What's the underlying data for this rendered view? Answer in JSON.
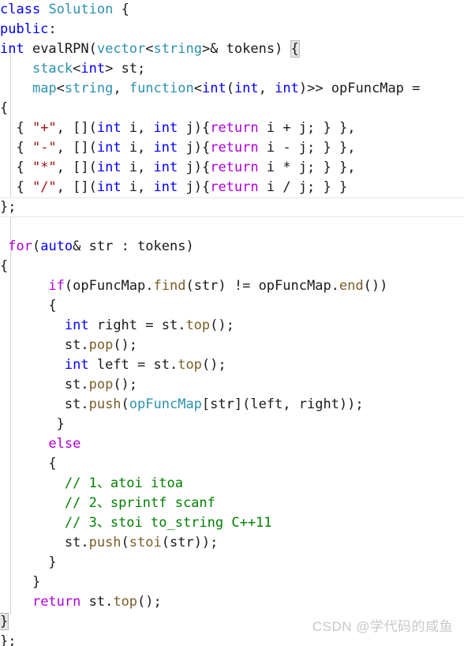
{
  "editor": {
    "language": "cpp",
    "theme": "light",
    "colors": {
      "background": "#ffffff",
      "foreground": "#1a1a1a",
      "keyword": "#0000ff",
      "control_keyword": "#af00db",
      "type": "#2b91af",
      "function": "#795e26",
      "string": "#a31515",
      "comment": "#008000",
      "indent_guide": "#d3d3d3",
      "bracket_match": "#e6e6e6",
      "watermark": "#c8c8c8"
    }
  },
  "code_lines": [
    {
      "id": "line-1",
      "tokens": [
        {
          "t": "class",
          "c": "kw"
        },
        {
          "t": " ",
          "c": "pln"
        },
        {
          "t": "Solution",
          "c": "typ"
        },
        {
          "t": " ",
          "c": "pln"
        },
        {
          "t": "{",
          "c": "brk"
        }
      ]
    },
    {
      "id": "line-2",
      "tokens": [
        {
          "t": "public",
          "c": "kw"
        },
        {
          "t": ":",
          "c": "pln"
        }
      ]
    },
    {
      "id": "line-3",
      "tokens": [
        {
          "t": "int",
          "c": "kw"
        },
        {
          "t": " evalRPN(",
          "c": "pln"
        },
        {
          "t": "vector",
          "c": "typ"
        },
        {
          "t": "<",
          "c": "pln"
        },
        {
          "t": "string",
          "c": "typ"
        },
        {
          "t": ">& tokens) ",
          "c": "pln"
        },
        {
          "t": "{",
          "c": "brk bmatch"
        }
      ]
    },
    {
      "id": "line-4",
      "tokens": [
        {
          "t": "    ",
          "c": "pln"
        },
        {
          "t": "stack",
          "c": "typ"
        },
        {
          "t": "<",
          "c": "pln"
        },
        {
          "t": "int",
          "c": "kw"
        },
        {
          "t": "> st;",
          "c": "pln"
        }
      ]
    },
    {
      "id": "line-5",
      "tokens": [
        {
          "t": "    ",
          "c": "pln"
        },
        {
          "t": "map",
          "c": "typ"
        },
        {
          "t": "<",
          "c": "pln"
        },
        {
          "t": "string",
          "c": "typ"
        },
        {
          "t": ", ",
          "c": "pln"
        },
        {
          "t": "function",
          "c": "typ"
        },
        {
          "t": "<",
          "c": "pln"
        },
        {
          "t": "int",
          "c": "kw"
        },
        {
          "t": "(",
          "c": "pln"
        },
        {
          "t": "int",
          "c": "kw"
        },
        {
          "t": ", ",
          "c": "pln"
        },
        {
          "t": "int",
          "c": "kw"
        },
        {
          "t": ")>> opFuncMap =",
          "c": "pln"
        }
      ]
    },
    {
      "id": "line-6",
      "tokens": [
        {
          "t": "{",
          "c": "brk"
        }
      ]
    },
    {
      "id": "line-7",
      "tokens": [
        {
          "t": "  { ",
          "c": "pln"
        },
        {
          "t": "\"+\"",
          "c": "str"
        },
        {
          "t": ", [](",
          "c": "pln"
        },
        {
          "t": "int",
          "c": "kw"
        },
        {
          "t": " i, ",
          "c": "pln"
        },
        {
          "t": "int",
          "c": "kw"
        },
        {
          "t": " j){",
          "c": "pln"
        },
        {
          "t": "return",
          "c": "ctl"
        },
        {
          "t": " i + j; } },",
          "c": "pln"
        }
      ]
    },
    {
      "id": "line-8",
      "tokens": [
        {
          "t": "  { ",
          "c": "pln"
        },
        {
          "t": "\"-\"",
          "c": "str"
        },
        {
          "t": ", [](",
          "c": "pln"
        },
        {
          "t": "int",
          "c": "kw"
        },
        {
          "t": " i, ",
          "c": "pln"
        },
        {
          "t": "int",
          "c": "kw"
        },
        {
          "t": " j){",
          "c": "pln"
        },
        {
          "t": "return",
          "c": "ctl"
        },
        {
          "t": " i - j; } },",
          "c": "pln"
        }
      ]
    },
    {
      "id": "line-9",
      "tokens": [
        {
          "t": "  { ",
          "c": "pln"
        },
        {
          "t": "\"*\"",
          "c": "str"
        },
        {
          "t": ", [](",
          "c": "pln"
        },
        {
          "t": "int",
          "c": "kw"
        },
        {
          "t": " i, ",
          "c": "pln"
        },
        {
          "t": "int",
          "c": "kw"
        },
        {
          "t": " j){",
          "c": "pln"
        },
        {
          "t": "return",
          "c": "ctl"
        },
        {
          "t": " i * j; } },",
          "c": "pln"
        }
      ]
    },
    {
      "id": "line-10",
      "tokens": [
        {
          "t": "  { ",
          "c": "pln"
        },
        {
          "t": "\"/\"",
          "c": "str"
        },
        {
          "t": ", [](",
          "c": "pln"
        },
        {
          "t": "int",
          "c": "kw"
        },
        {
          "t": " i, ",
          "c": "pln"
        },
        {
          "t": "int",
          "c": "kw"
        },
        {
          "t": " j){",
          "c": "pln"
        },
        {
          "t": "return",
          "c": "ctl"
        },
        {
          "t": " i / j; } }",
          "c": "pln"
        }
      ]
    },
    {
      "id": "line-11",
      "current": true,
      "tokens": [
        {
          "t": "};",
          "c": "pln"
        }
      ]
    },
    {
      "id": "line-12",
      "tokens": []
    },
    {
      "id": "line-13",
      "tokens": [
        {
          "t": " ",
          "c": "pln"
        },
        {
          "t": "for",
          "c": "ctl"
        },
        {
          "t": "(",
          "c": "pln"
        },
        {
          "t": "auto",
          "c": "kw"
        },
        {
          "t": "& str : tokens)",
          "c": "pln"
        }
      ]
    },
    {
      "id": "line-14",
      "tokens": [
        {
          "t": "{",
          "c": "brk"
        }
      ]
    },
    {
      "id": "line-15",
      "tokens": [
        {
          "t": "      ",
          "c": "pln"
        },
        {
          "t": "if",
          "c": "ctl"
        },
        {
          "t": "(opFuncMap.",
          "c": "pln"
        },
        {
          "t": "find",
          "c": "fn"
        },
        {
          "t": "(str) != opFuncMap.",
          "c": "pln"
        },
        {
          "t": "end",
          "c": "fn"
        },
        {
          "t": "())",
          "c": "pln"
        }
      ]
    },
    {
      "id": "line-16",
      "tokens": [
        {
          "t": "      {",
          "c": "pln"
        }
      ]
    },
    {
      "id": "line-17",
      "tokens": [
        {
          "t": "        ",
          "c": "pln"
        },
        {
          "t": "int",
          "c": "kw"
        },
        {
          "t": " right = st.",
          "c": "pln"
        },
        {
          "t": "top",
          "c": "fn"
        },
        {
          "t": "();",
          "c": "pln"
        }
      ]
    },
    {
      "id": "line-18",
      "tokens": [
        {
          "t": "        st.",
          "c": "pln"
        },
        {
          "t": "pop",
          "c": "fn"
        },
        {
          "t": "();",
          "c": "pln"
        }
      ]
    },
    {
      "id": "line-19",
      "tokens": [
        {
          "t": "        ",
          "c": "pln"
        },
        {
          "t": "int",
          "c": "kw"
        },
        {
          "t": " left = st.",
          "c": "pln"
        },
        {
          "t": "top",
          "c": "fn"
        },
        {
          "t": "();",
          "c": "pln"
        }
      ]
    },
    {
      "id": "line-20",
      "tokens": [
        {
          "t": "        st.",
          "c": "pln"
        },
        {
          "t": "pop",
          "c": "fn"
        },
        {
          "t": "();",
          "c": "pln"
        }
      ]
    },
    {
      "id": "line-21",
      "tokens": [
        {
          "t": "        st.",
          "c": "pln"
        },
        {
          "t": "push",
          "c": "fn"
        },
        {
          "t": "(",
          "c": "pln"
        },
        {
          "t": "opFuncMap",
          "c": "typ"
        },
        {
          "t": "[str](left, right));",
          "c": "pln"
        }
      ]
    },
    {
      "id": "line-22",
      "tokens": [
        {
          "t": "       }",
          "c": "pln"
        }
      ]
    },
    {
      "id": "line-23",
      "tokens": [
        {
          "t": "      ",
          "c": "pln"
        },
        {
          "t": "else",
          "c": "ctl"
        }
      ]
    },
    {
      "id": "line-24",
      "tokens": [
        {
          "t": "      {",
          "c": "pln"
        }
      ]
    },
    {
      "id": "line-25",
      "tokens": [
        {
          "t": "        ",
          "c": "pln"
        },
        {
          "t": "// 1、atoi itoa",
          "c": "cmt"
        }
      ]
    },
    {
      "id": "line-26",
      "tokens": [
        {
          "t": "        ",
          "c": "pln"
        },
        {
          "t": "// 2、sprintf scanf",
          "c": "cmt"
        }
      ]
    },
    {
      "id": "line-27",
      "tokens": [
        {
          "t": "        ",
          "c": "pln"
        },
        {
          "t": "// 3、stoi to_string C++11",
          "c": "cmt"
        }
      ]
    },
    {
      "id": "line-28",
      "tokens": [
        {
          "t": "        st.",
          "c": "pln"
        },
        {
          "t": "push",
          "c": "fn"
        },
        {
          "t": "(",
          "c": "pln"
        },
        {
          "t": "stoi",
          "c": "fn"
        },
        {
          "t": "(str));",
          "c": "pln"
        }
      ]
    },
    {
      "id": "line-29",
      "tokens": [
        {
          "t": "      }",
          "c": "pln"
        }
      ]
    },
    {
      "id": "line-30",
      "tokens": [
        {
          "t": "    }",
          "c": "pln"
        }
      ]
    },
    {
      "id": "line-31",
      "tokens": [
        {
          "t": "    ",
          "c": "pln"
        },
        {
          "t": "return",
          "c": "ctl"
        },
        {
          "t": " st.",
          "c": "pln"
        },
        {
          "t": "top",
          "c": "fn"
        },
        {
          "t": "();",
          "c": "pln"
        }
      ]
    },
    {
      "id": "line-32",
      "tokens": [
        {
          "t": "}",
          "c": "brk bmatch"
        }
      ]
    },
    {
      "id": "line-33",
      "tokens": [
        {
          "t": "};",
          "c": "pln"
        }
      ]
    }
  ],
  "watermark": {
    "text": "CSDN @学代码的咸鱼"
  }
}
